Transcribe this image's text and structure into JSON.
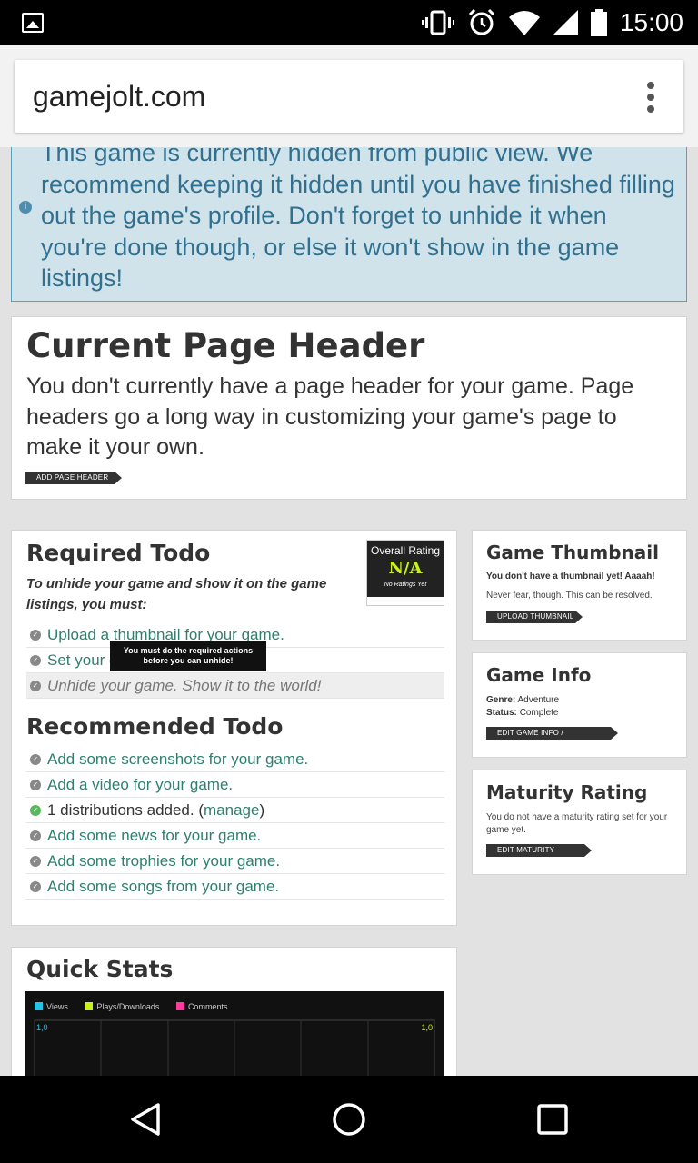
{
  "status_bar": {
    "time": "15:00"
  },
  "browser": {
    "url": "gamejolt.com"
  },
  "alert": {
    "message": "This game is currently hidden from public view. We recommend keeping it hidden until you have finished filling out the game's profile. Don't forget to unhide it when you're done though, or else it won't show in the game listings!"
  },
  "page_header_card": {
    "title": "Current Page Header",
    "description": "You don't currently have a page header for your game. Page headers go a long way in customizing your game's page to make it your own.",
    "button": "ADD PAGE HEADER"
  },
  "required_todo": {
    "title": "Required Todo",
    "intro": "To unhide your game and show it on the game listings, you must:",
    "items": [
      "Upload a thumbnail for your game.",
      "Set your game's maturity rating.",
      "Unhide your game. Show it to the world!"
    ],
    "tooltip": "You must do the required actions before you can unhide!"
  },
  "rating_box": {
    "label": "Overall Rating",
    "value": "N/A",
    "sub": "No Ratings Yet"
  },
  "recommended_todo": {
    "title": "Recommended Todo",
    "items": [
      "Add some screenshots for your game.",
      "Add a video for your game.",
      "Add some news for your game.",
      "Add some trophies for your game.",
      "Add some songs from your game."
    ],
    "distributions_prefix": "1 distributions added. (",
    "distributions_link": "manage",
    "distributions_suffix": ")"
  },
  "game_thumbnail": {
    "title": "Game Thumbnail",
    "line1": "You don't have a thumbnail yet! Aaaah!",
    "line2": "Never fear, though. This can be resolved.",
    "button": "UPLOAD THUMBNAIL"
  },
  "game_info": {
    "title": "Game Info",
    "genre_label": "Genre:",
    "genre_value": "Adventure",
    "status_label": "Status:",
    "status_value": "Complete",
    "button": "EDIT GAME INFO / DESCRIPTION"
  },
  "maturity_rating": {
    "title": "Maturity Rating",
    "text": "You do not have a maturity rating set for your game yet.",
    "button": "EDIT MATURITY RATING"
  },
  "quick_stats": {
    "title": "Quick Stats",
    "legend": [
      {
        "label": "Views",
        "color": "#27c3e6"
      },
      {
        "label": "Plays/Downloads",
        "color": "#c9f21a"
      },
      {
        "label": "Comments",
        "color": "#ff3a9a"
      }
    ],
    "left_axis": "1,0",
    "right_axis": "1,0"
  }
}
